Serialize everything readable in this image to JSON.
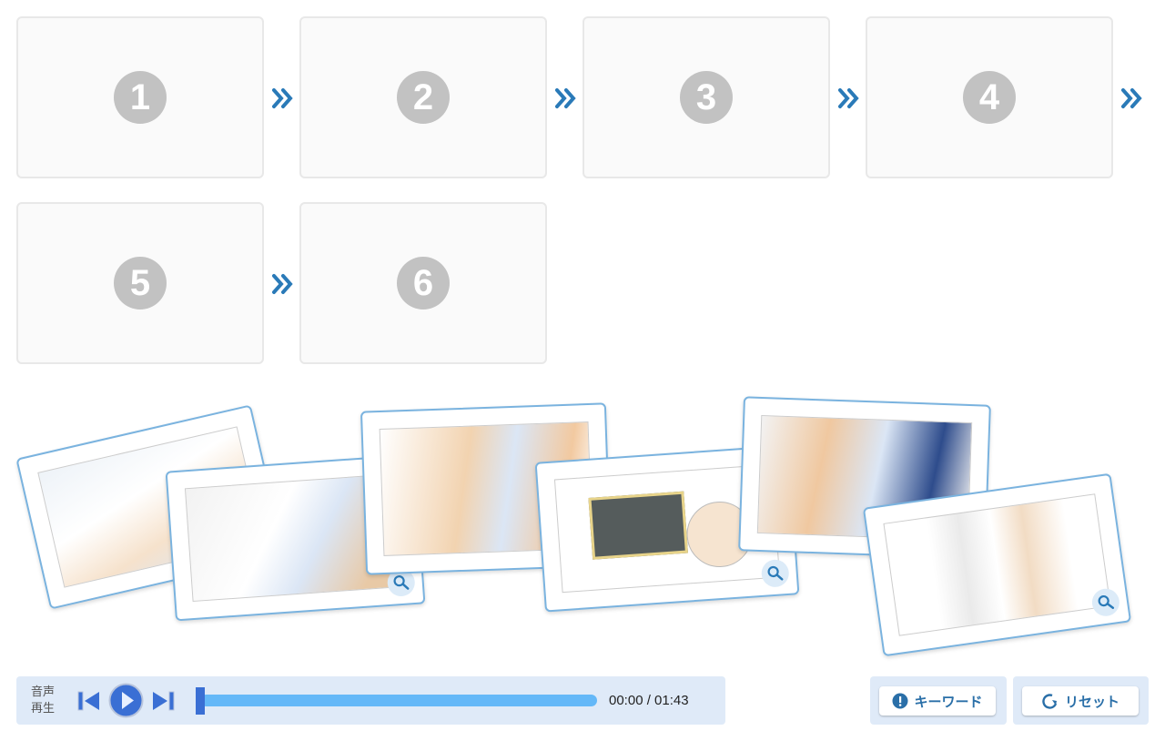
{
  "slots": [
    {
      "label": "1"
    },
    {
      "label": "2"
    },
    {
      "label": "3"
    },
    {
      "label": "4"
    },
    {
      "label": "5"
    },
    {
      "label": "6"
    }
  ],
  "cards": [
    {
      "icon": "zoom-icon"
    },
    {
      "icon": "zoom-icon"
    },
    {
      "icon": "zoom-icon"
    },
    {
      "icon": "zoom-icon"
    },
    {
      "icon": "zoom-icon"
    },
    {
      "icon": "zoom-icon"
    }
  ],
  "player": {
    "label_line1": "音声",
    "label_line2": "再生",
    "time": "00:00 / 01:43",
    "progress": 0
  },
  "buttons": {
    "keyword": "キーワード",
    "reset": "リセット"
  },
  "colors": {
    "accent": "#2a7ab8",
    "player_bg": "#dfeaf8",
    "progress": "#64b8f8",
    "play": "#3a6fd4",
    "card_border": "#7ab3df"
  }
}
